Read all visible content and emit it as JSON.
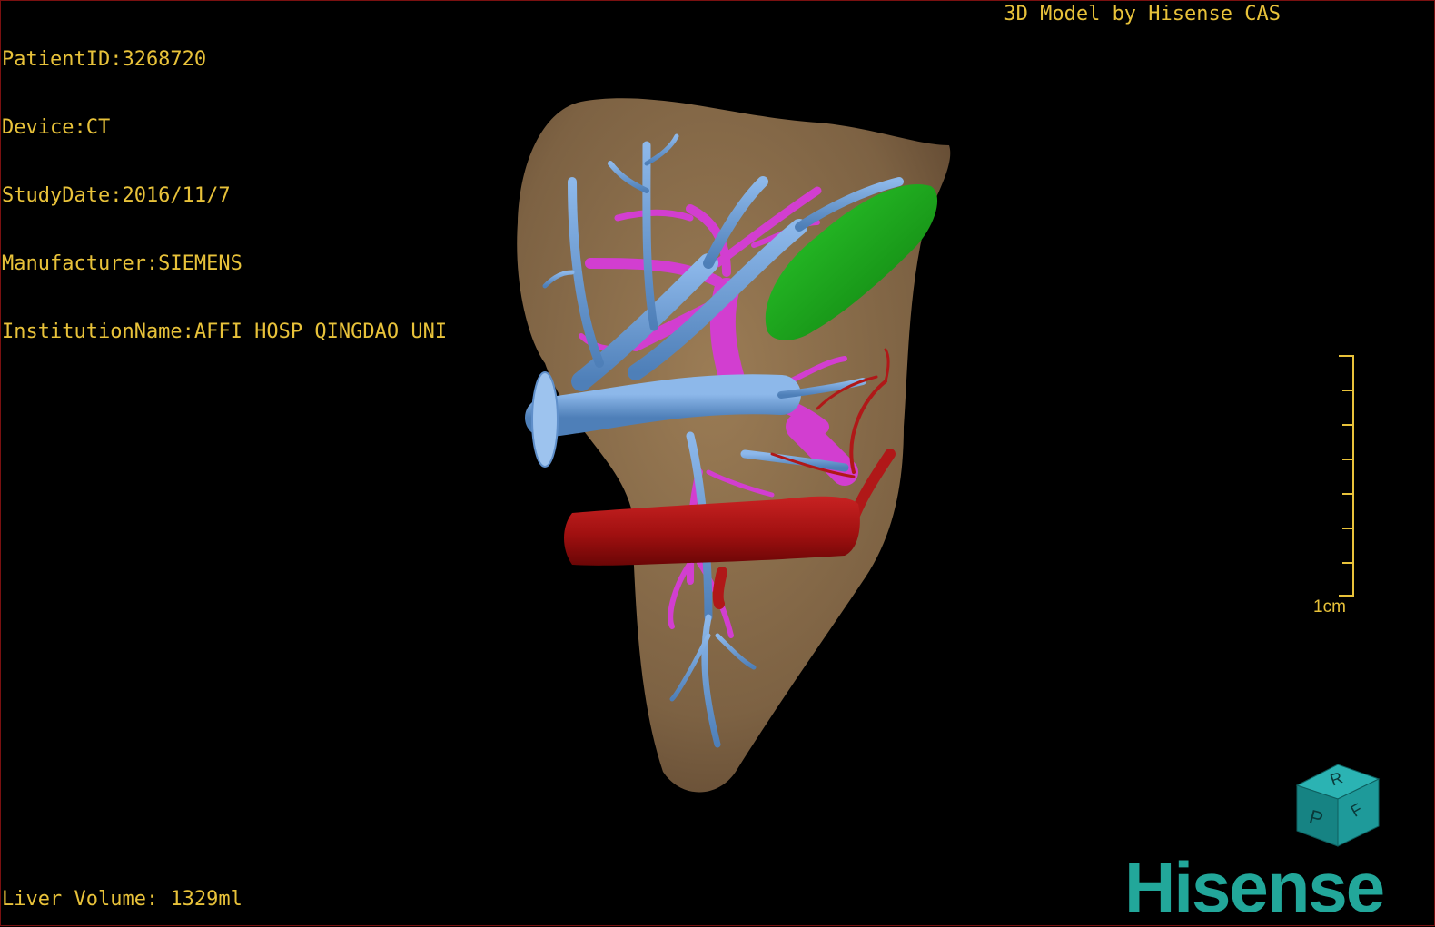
{
  "info": {
    "patient_id": "PatientID:3268720",
    "device": "Device:CT",
    "study_date": "StudyDate:2016/11/7",
    "manufacturer": "Manufacturer:SIEMENS",
    "institution": "InstitutionName:AFFI HOSP QINGDAO UNI"
  },
  "watermark": "3D Model by Hisense CAS",
  "liver_volume": "Liver Volume: 1329ml",
  "scale_bar": {
    "label": "1cm"
  },
  "orientation_cube": {
    "face_top": "R",
    "face_front": "P",
    "face_side": "F"
  },
  "logo_text": "Hisense",
  "colors": {
    "text": "#e8c23a",
    "liver": "#8a6e4b",
    "hepatic_vein": "#6f9fd8",
    "portal_vein": "#d23ed0",
    "artery_ivc": "#b01818",
    "gallbladder": "#1fa31f",
    "logo": "#22a79a",
    "cube": "#1a8a8a"
  }
}
